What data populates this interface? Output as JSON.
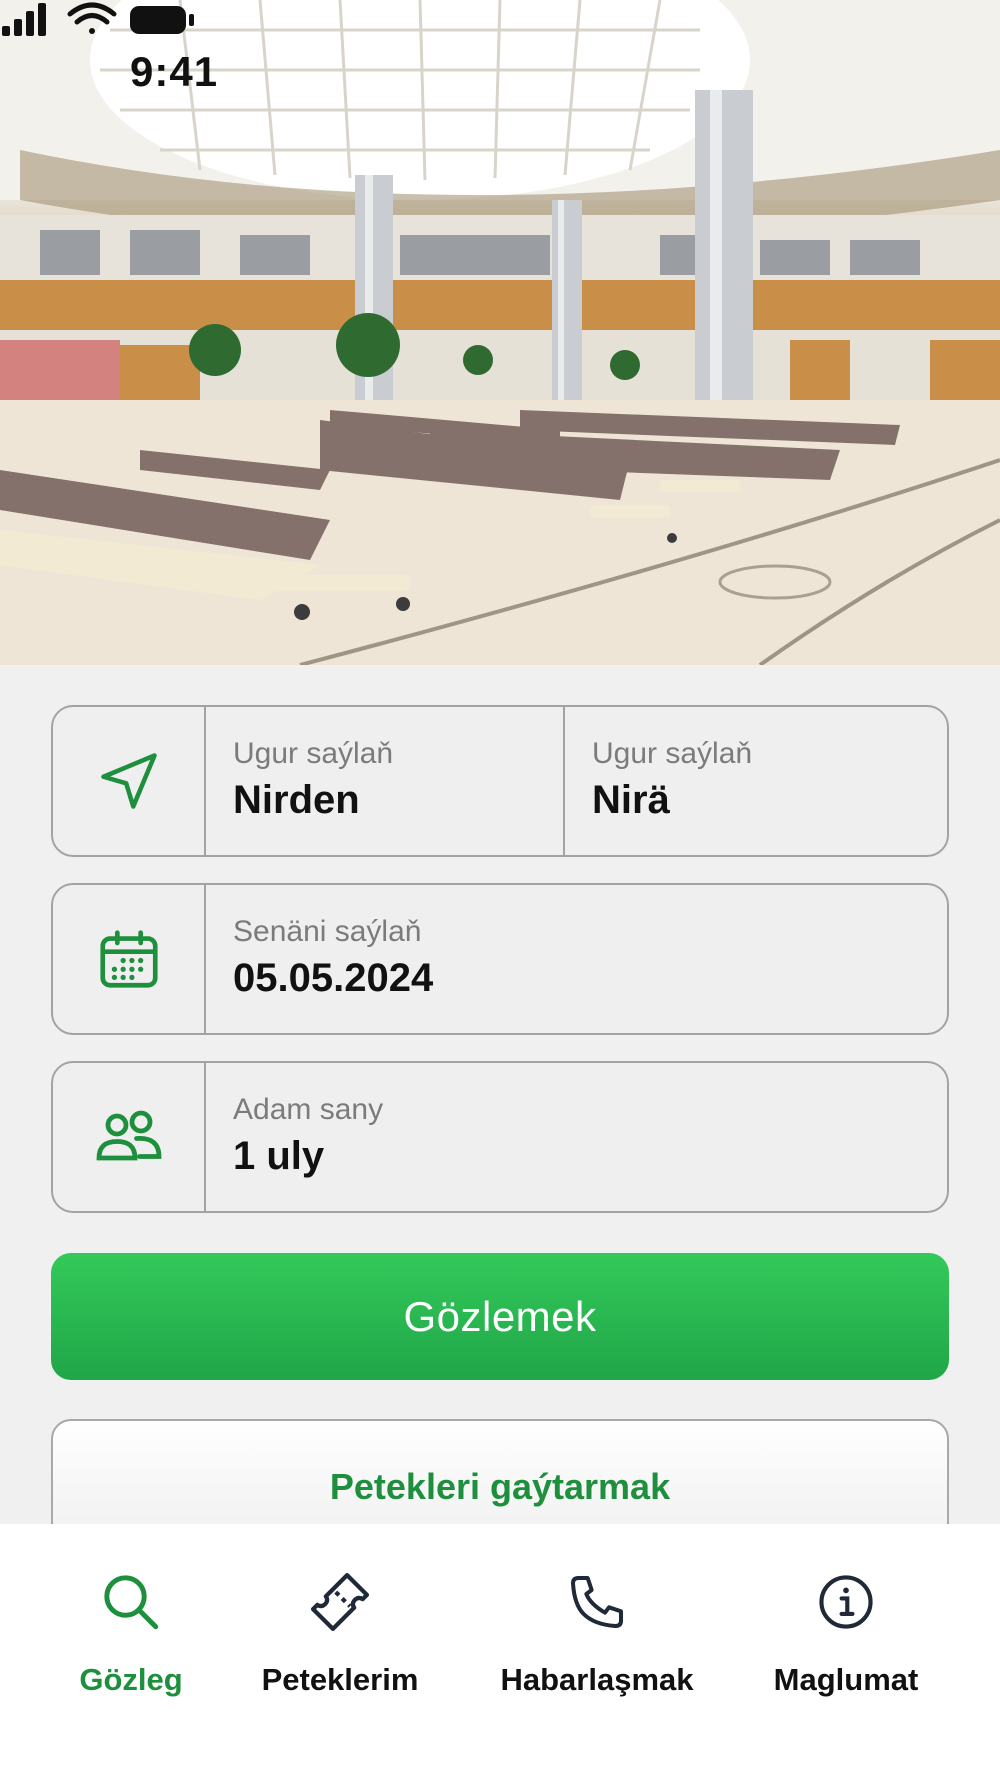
{
  "status_bar": {
    "time": "9:41"
  },
  "route": {
    "from": {
      "label": "Ugur saýlaň",
      "value": "Nirden"
    },
    "to": {
      "label": "Ugur saýlaň",
      "value": "Nirä"
    }
  },
  "date": {
    "label": "Senäni saýlaň",
    "value": "05.05.2024"
  },
  "passengers": {
    "label": "Adam sany",
    "value": "1 uly"
  },
  "actions": {
    "search_label": "Gözlemek",
    "return_tickets_label": "Petekleri gaýtarmak"
  },
  "tabs": [
    {
      "label": "Gözleg",
      "icon": "search-icon",
      "active": true
    },
    {
      "label": "Peteklerim",
      "icon": "ticket-icon",
      "active": false
    },
    {
      "label": "Habarlaşmak",
      "icon": "phone-icon",
      "active": false
    },
    {
      "label": "Maglumat",
      "icon": "info-icon",
      "active": false
    }
  ],
  "colors": {
    "accent": "#1e8f3c",
    "button_green": "#2bbf52",
    "background": "#f0f0f0"
  }
}
